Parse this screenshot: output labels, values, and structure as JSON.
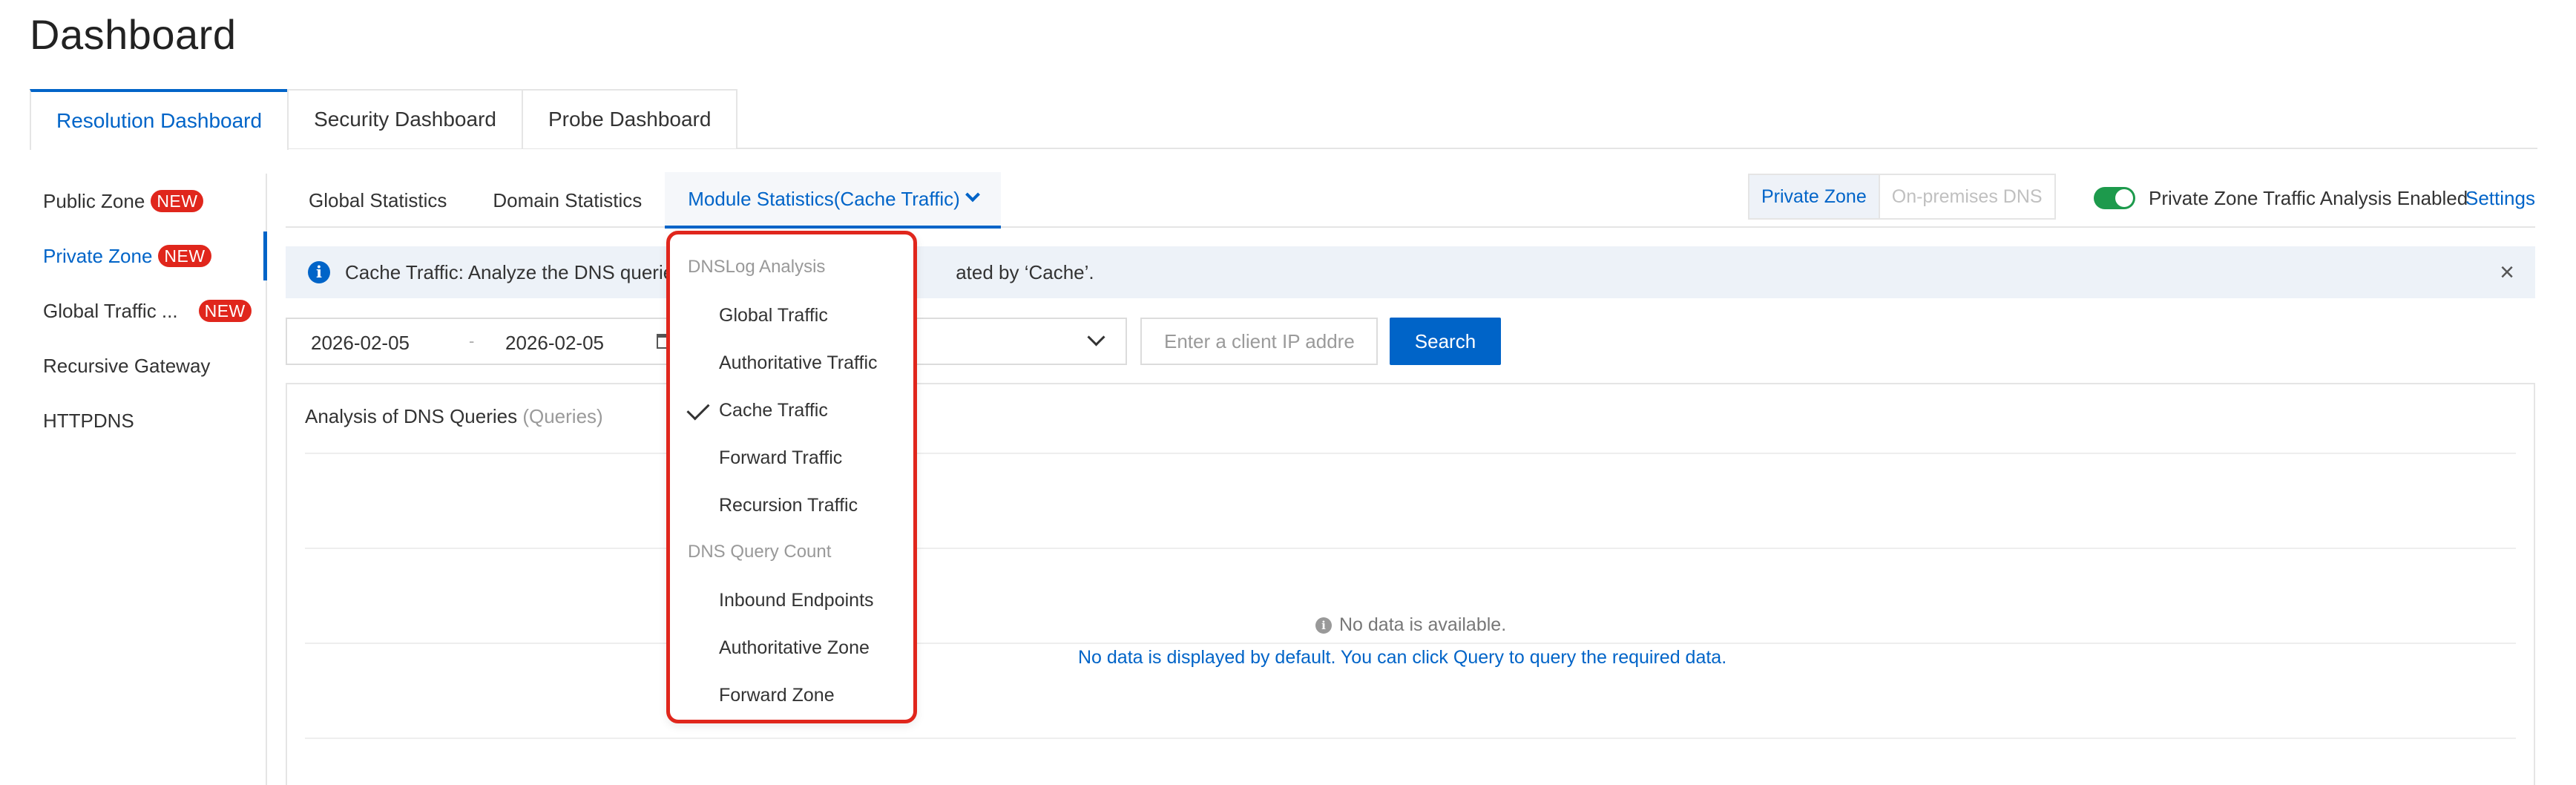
{
  "page": {
    "title": "Dashboard"
  },
  "top_tabs": [
    {
      "label": "Resolution Dashboard",
      "active": true
    },
    {
      "label": "Security Dashboard",
      "active": false
    },
    {
      "label": "Probe Dashboard",
      "active": false
    }
  ],
  "sidebar": {
    "items": [
      {
        "label": "Public Zone",
        "badge": "NEW",
        "active": false
      },
      {
        "label": "Private Zone",
        "badge": "NEW",
        "active": true
      },
      {
        "label": "Global Traffic ...",
        "badge": "NEW",
        "active": false
      },
      {
        "label": "Recursive Gateway",
        "active": false
      },
      {
        "label": "HTTPDNS",
        "active": false
      }
    ]
  },
  "sub_tabs": [
    {
      "label": "Global Statistics",
      "active": false
    },
    {
      "label": "Domain Statistics",
      "active": false
    },
    {
      "label": "Module Statistics(Cache Traffic)",
      "active": true
    }
  ],
  "zone_toggle": {
    "private": "Private Zone",
    "onprem": "On-premises DNS",
    "selected": "Private Zone"
  },
  "traffic_analysis": {
    "label": "Private Zone Traffic Analysis Enabled",
    "enabled": true,
    "settings_link": "Settings"
  },
  "alert": {
    "text_visible_start": "Cache Traffic: Analyze the DNS querie",
    "text_visible_end": "ated by ‘Cache’.",
    "close": "×"
  },
  "filters": {
    "start_date": "2026-02-05",
    "separator": "-",
    "end_date": "2026-02-05",
    "ip_placeholder": "Enter a client IP address",
    "search_label": "Search"
  },
  "panel": {
    "title": "Analysis of DNS Queries",
    "title_unit": "(Queries)",
    "no_data": "No data is available.",
    "no_data_hint": "No data is displayed by default. You can click Query to query the required data."
  },
  "dropdown": {
    "groups": [
      {
        "label": "DNSLog Analysis",
        "items": [
          {
            "label": "Global Traffic",
            "checked": false
          },
          {
            "label": "Authoritative Traffic",
            "checked": false
          },
          {
            "label": "Cache Traffic",
            "checked": true
          },
          {
            "label": "Forward Traffic",
            "checked": false
          },
          {
            "label": "Recursion Traffic",
            "checked": false
          }
        ]
      },
      {
        "label": "DNS Query Count",
        "items": [
          {
            "label": "Inbound Endpoints",
            "checked": false
          },
          {
            "label": "Authoritative Zone",
            "checked": false
          },
          {
            "label": "Forward Zone",
            "checked": false
          }
        ]
      }
    ]
  },
  "colors": {
    "accent": "#0064c8",
    "badge": "#e0261c",
    "toggle_on": "#1d9a4c",
    "highlight_border": "#e0261c"
  },
  "icons": {
    "info": "info-icon",
    "close": "close-icon",
    "calendar": "calendar-icon",
    "chevron": "chevron-down-icon",
    "check": "check-icon"
  }
}
